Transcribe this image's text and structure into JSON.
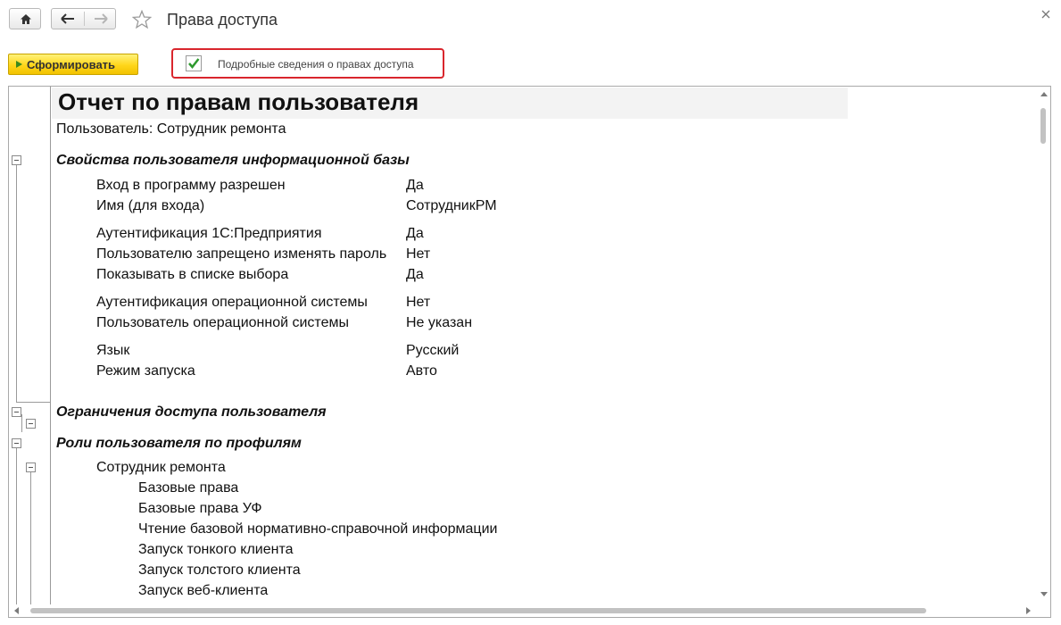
{
  "window": {
    "title": "Права доступа"
  },
  "toolbar": {
    "generate_label": "Сформировать",
    "detailed_checkbox_label": "Подробные сведения о правах доступа",
    "detailed_checked": true
  },
  "report": {
    "title": "Отчет по правам пользователя",
    "user_line": "Пользователь: Сотрудник ремонта",
    "sections": {
      "properties": "Свойства пользователя информационной базы",
      "restrictions": "Ограничения доступа пользователя",
      "roles": "Роли пользователя по профилям"
    },
    "properties": [
      {
        "label": "Вход в программу разрешен",
        "value": "Да"
      },
      {
        "label": "Имя (для входа)",
        "value": "СотрудникРМ"
      },
      {
        "label": "Аутентификация 1С:Предприятия",
        "value": "Да"
      },
      {
        "label": "Пользователю запрещено изменять пароль",
        "value": "Нет"
      },
      {
        "label": "Показывать в списке выбора",
        "value": "Да"
      },
      {
        "label": "Аутентификация операционной системы",
        "value": "Нет"
      },
      {
        "label": "Пользователь операционной системы",
        "value": "Не указан"
      },
      {
        "label": "Язык",
        "value": "Русский"
      },
      {
        "label": "Режим запуска",
        "value": "Авто"
      }
    ],
    "profile": {
      "name": "Сотрудник ремонта",
      "roles": [
        "Базовые права",
        "Базовые права УФ",
        "Чтение базовой нормативно-справочной информации",
        "Запуск тонкого клиента",
        "Запуск толстого клиента",
        "Запуск веб-клиента"
      ]
    }
  },
  "colors": {
    "highlight_border": "#d9262d",
    "generate_button": "#ffd61a",
    "check_mark": "#2e9a2e"
  }
}
